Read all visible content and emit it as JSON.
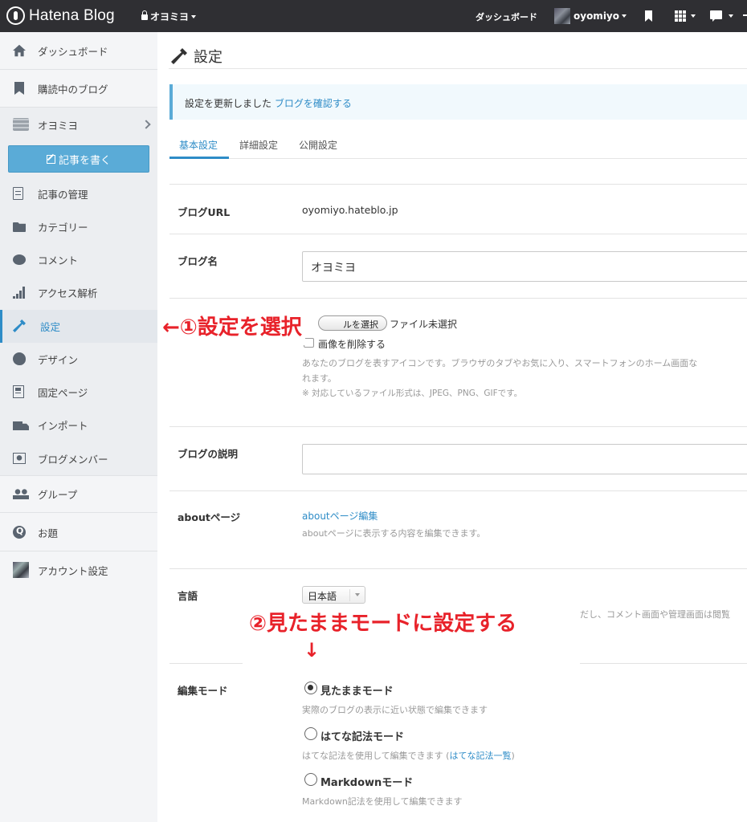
{
  "topbar": {
    "logo_text": "Hatena Blog",
    "blog_name": "オヨミヨ",
    "dashboard": "ダッシュボード",
    "username": "oyomiyo"
  },
  "sidebar": {
    "items": [
      {
        "label": "ダッシュボード",
        "icon": "home-icon"
      },
      {
        "label": "購読中のブログ",
        "icon": "bookmark-icon"
      },
      {
        "label": "オヨミヨ",
        "icon": "blog-icon"
      },
      {
        "label": "記事の管理",
        "icon": "document-icon"
      },
      {
        "label": "カテゴリー",
        "icon": "folder-icon"
      },
      {
        "label": "コメント",
        "icon": "comment-icon"
      },
      {
        "label": "アクセス解析",
        "icon": "bar-chart-icon"
      },
      {
        "label": "設定",
        "icon": "wrench-icon"
      },
      {
        "label": "デザイン",
        "icon": "palette-icon"
      },
      {
        "label": "固定ページ",
        "icon": "page-icon"
      },
      {
        "label": "インポート",
        "icon": "truck-icon"
      },
      {
        "label": "ブログメンバー",
        "icon": "member-icon"
      },
      {
        "label": "グループ",
        "icon": "group-icon"
      },
      {
        "label": "お題",
        "icon": "odai-icon"
      },
      {
        "label": "アカウント設定",
        "icon": "account-icon"
      }
    ],
    "write_button": "記事を書く",
    "active_color": "#2e8cc7"
  },
  "main": {
    "title": "設定",
    "notice_text": "設定を更新しました",
    "notice_link": "ブログを確認する",
    "tabs": [
      "基本設定",
      "詳細設定",
      "公開設定"
    ],
    "blog_url_label": "ブログURL",
    "blog_url_value": "oyomiyo.hateblo.jp",
    "blog_name_label": "ブログ名",
    "blog_name_value": "オヨミヨ",
    "file_button": "ファイルを選択",
    "file_button_visible": "ルを選択",
    "file_status": "ファイル未選択",
    "delete_image": "画像を削除する",
    "icon_help_1": "あなたのブログを表すアイコンです。ブラウザのタブやお気に入り、スマートフォンのホーム画面な",
    "icon_help_2": "れます。",
    "icon_help_3": "※ 対応しているファイル形式は、JPEG、PNG、GIFです。",
    "desc_label": "ブログの説明",
    "about_label": "aboutページ",
    "about_link": "aboutページ編集",
    "about_help": "aboutページに表示する内容を編集できます。",
    "lang_label": "言語",
    "lang_value": "日本語",
    "lang_help": "だし、コメント画面や管理画面は閲覧",
    "editor_label": "編集モード",
    "modes": [
      {
        "label": "見たままモード",
        "help": "実際のブログの表示に近い状態で編集できます",
        "selected": true
      },
      {
        "label": "はてな記法モード",
        "help": "はてな記法を使用して編集できます (",
        "help_link": "はてな記法一覧",
        "help_end": ")",
        "selected": false
      },
      {
        "label": "Markdownモード",
        "help": "Markdown記法を使用して編集できます",
        "selected": false
      }
    ]
  },
  "annotations": {
    "step1": "←①設定を選択",
    "step2": "②見たままモードに設定する",
    "arrow_down": "↓",
    "color": "#e8222a"
  }
}
